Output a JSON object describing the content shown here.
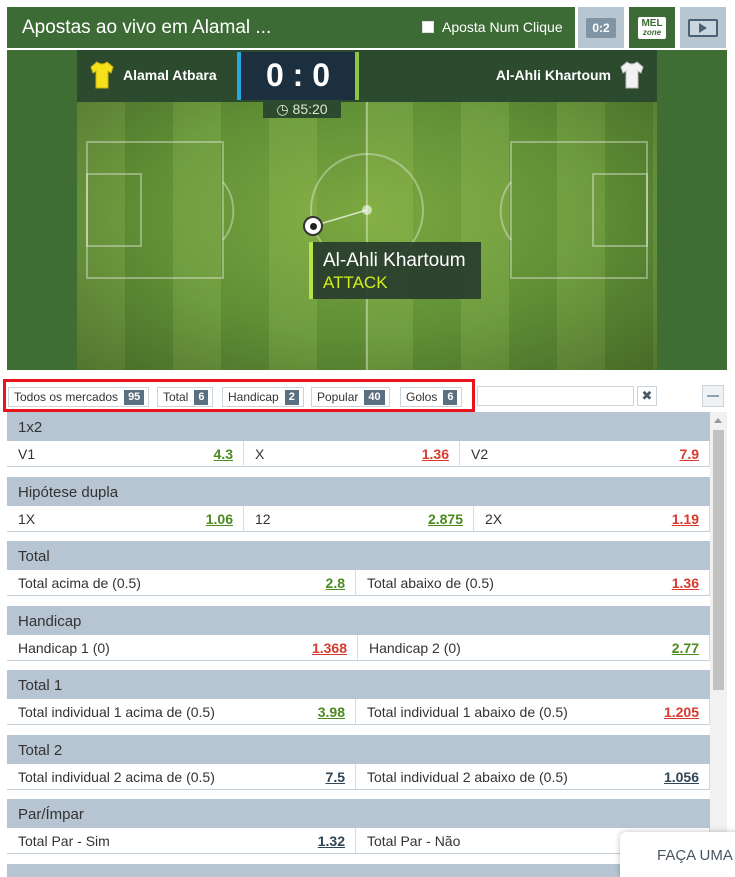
{
  "header": {
    "title": "Apostas ao vivo em Alamal ...",
    "one_click_label": "Aposta Num Clique",
    "score_button_label": "0:2",
    "mel_top": "MEL",
    "mel_bottom": "zone"
  },
  "match": {
    "home_team": "Alamal Atbara",
    "away_team": "Al-Ahli Khartoum",
    "score": "0 : 0",
    "time": "85:20",
    "event_team": "Al-Ahli Khartoum",
    "event_type": "ATTACK",
    "colors": {
      "home_shirt": "#f5e11a",
      "away_shirt": "#f2f2f2",
      "home_accent": "#2aa7e0",
      "away_accent": "#8cc63f"
    }
  },
  "filters": [
    {
      "label": "Todos os mercados",
      "count": "95"
    },
    {
      "label": "Total",
      "count": "6"
    },
    {
      "label": "Handicap",
      "count": "2"
    },
    {
      "label": "Popular",
      "count": "40"
    },
    {
      "label": "Golos",
      "count": "6"
    }
  ],
  "markets": [
    {
      "title": "1x2",
      "outcomes": [
        {
          "label": "V1",
          "odd": "4.3",
          "trend": "green"
        },
        {
          "label": "X",
          "odd": "1.36",
          "trend": "red"
        },
        {
          "label": "V2",
          "odd": "7.9",
          "trend": "red"
        }
      ]
    },
    {
      "title": "Hipótese dupla",
      "outcomes": [
        {
          "label": "1X",
          "odd": "1.06",
          "trend": "green"
        },
        {
          "label": "12",
          "odd": "2.875",
          "trend": "green"
        },
        {
          "label": "2X",
          "odd": "1.19",
          "trend": "red"
        }
      ]
    },
    {
      "title": "Total",
      "outcomes": [
        {
          "label": "Total acima de (0.5)",
          "odd": "2.8",
          "trend": "green"
        },
        {
          "label": "Total abaixo de (0.5)",
          "odd": "1.36",
          "trend": "red"
        }
      ]
    },
    {
      "title": "Handicap",
      "outcomes": [
        {
          "label": "Handicap 1 (0)",
          "odd": "1.368",
          "trend": "red"
        },
        {
          "label": "Handicap 2 (0)",
          "odd": "2.77",
          "trend": "green"
        }
      ]
    },
    {
      "title": "Total 1",
      "outcomes": [
        {
          "label": "Total individual 1 acima de (0.5)",
          "odd": "3.98",
          "trend": "green"
        },
        {
          "label": "Total individual 1 abaixo de (0.5)",
          "odd": "1.205",
          "trend": "red"
        }
      ]
    },
    {
      "title": "Total 2",
      "outcomes": [
        {
          "label": "Total individual 2 acima de (0.5)",
          "odd": "7.5",
          "trend": "dark"
        },
        {
          "label": "Total individual 2 abaixo de (0.5)",
          "odd": "1.056",
          "trend": "dark"
        }
      ]
    },
    {
      "title": "Par/Ímpar",
      "outcomes": [
        {
          "label": "Total Par - Sim",
          "odd": "1.32",
          "trend": "dark"
        },
        {
          "label": "Total Par - Não",
          "odd": "",
          "trend": "dark"
        }
      ]
    },
    {
      "title": "",
      "outcomes": []
    }
  ],
  "popup": {
    "label": "FAÇA UMA"
  }
}
